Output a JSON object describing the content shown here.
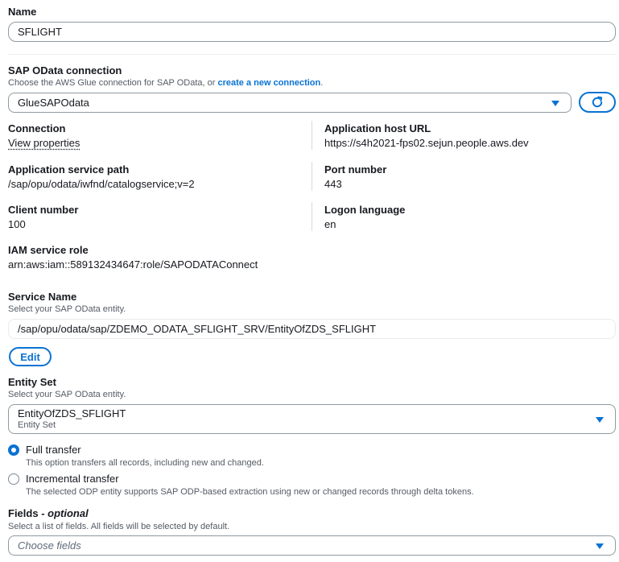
{
  "name_section": {
    "label": "Name",
    "value": "SFLIGHT"
  },
  "connection_section": {
    "label": "SAP OData connection",
    "desc_prefix": "Choose the AWS Glue connection for SAP OData, or ",
    "desc_link": "create a new connection",
    "desc_suffix": ".",
    "selected": "GlueSAPOdata"
  },
  "details": {
    "connection_label": "Connection",
    "connection_link": "View properties",
    "host_label": "Application host URL",
    "host_value": "https://s4h2021-fps02.sejun.people.aws.dev",
    "path_label": "Application service path",
    "path_value": "/sap/opu/odata/iwfnd/catalogservice;v=2",
    "port_label": "Port number",
    "port_value": "443",
    "client_label": "Client number",
    "client_value": "100",
    "logon_label": "Logon language",
    "logon_value": "en",
    "iam_label": "IAM service role",
    "iam_value": "arn:aws:iam::589132434647:role/SAPODATAConnect"
  },
  "service_section": {
    "label": "Service Name",
    "desc": "Select your SAP OData entity.",
    "value": "/sap/opu/odata/sap/ZDEMO_ODATA_SFLIGHT_SRV/EntityOfZDS_SFLIGHT",
    "edit_label": "Edit"
  },
  "entity_section": {
    "label": "Entity Set",
    "desc": "Select your SAP OData entity.",
    "selected": "EntityOfZDS_SFLIGHT",
    "selected_sub": "Entity Set"
  },
  "transfer": {
    "full_label": "Full transfer",
    "full_desc": "This option transfers all records, including new and changed.",
    "incremental_label": "Incremental transfer",
    "incremental_desc": "The selected ODP entity supports SAP ODP-based extraction using new or changed records through delta tokens.",
    "selected": "full"
  },
  "fields_section": {
    "label": "Fields",
    "label_suffix": " - optional",
    "desc": "Select a list of fields. All fields will be selected by default.",
    "placeholder": "Choose fields"
  },
  "colors": {
    "accent": "#0972d3",
    "text": "#16191f",
    "muted": "#545b64",
    "border": "#8d9aa3"
  },
  "icons": {
    "dropdown": "caret-down-icon",
    "refresh": "refresh-icon"
  }
}
